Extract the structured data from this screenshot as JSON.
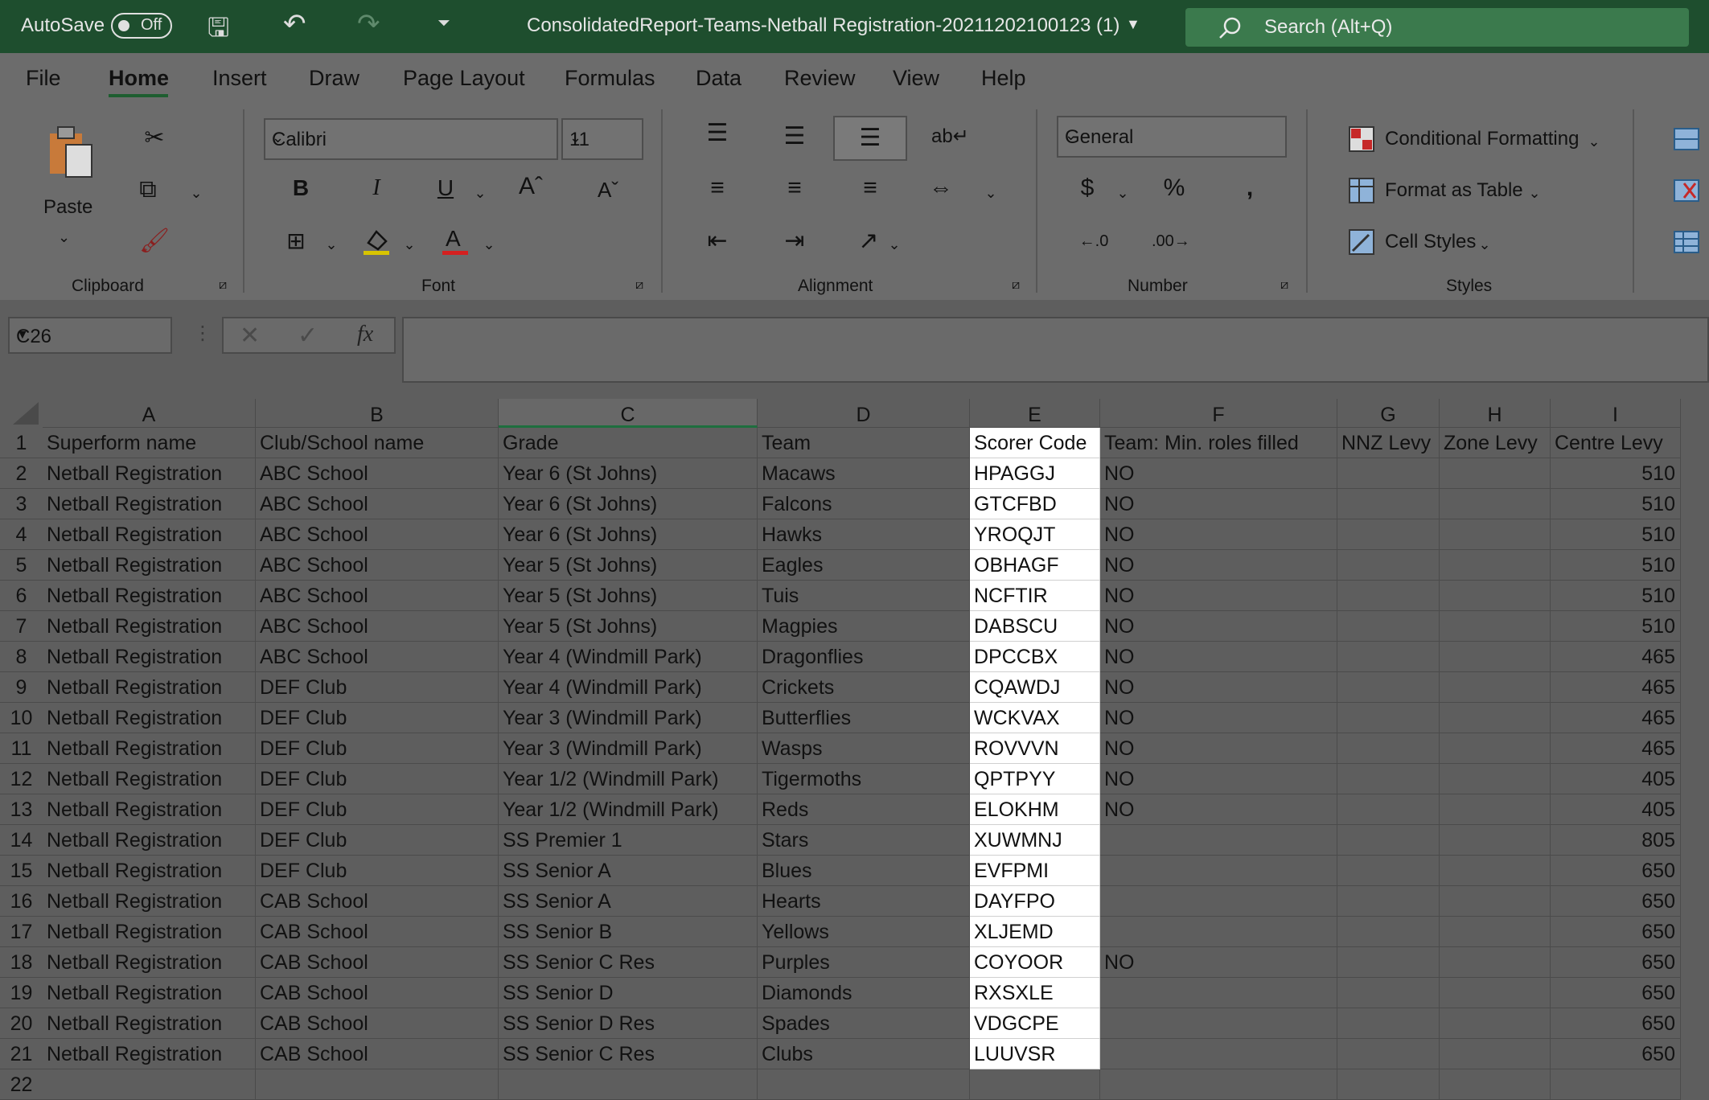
{
  "titlebar": {
    "autosave_label": "AutoSave",
    "autosave_state": "Off",
    "filename": "ConsolidatedReport-Teams-Netball Registration-20211202100123 (1)",
    "search_placeholder": "Search (Alt+Q)"
  },
  "tabs": [
    "File",
    "Home",
    "Insert",
    "Draw",
    "Page Layout",
    "Formulas",
    "Data",
    "Review",
    "View",
    "Help"
  ],
  "ribbon": {
    "paste_label": "Paste",
    "font_name": "Calibri",
    "font_size": "11",
    "number_format": "General",
    "conditional_formatting": "Conditional Formatting",
    "format_as_table": "Format as Table",
    "cell_styles": "Cell Styles",
    "groups": {
      "clipboard": "Clipboard",
      "font": "Font",
      "alignment": "Alignment",
      "number": "Number",
      "styles": "Styles"
    }
  },
  "formula_bar": {
    "name_box": "C26",
    "fx": "fx",
    "formula": ""
  },
  "columns": [
    "A",
    "B",
    "C",
    "D",
    "E",
    "F",
    "G",
    "H",
    "I"
  ],
  "rows": [
    [
      "1",
      "Superform name",
      "Club/School name",
      "Grade",
      "Team",
      "Scorer Code",
      "Team: Min. roles filled",
      "NNZ Levy",
      "Zone Levy",
      "Centre Levy"
    ],
    [
      "2",
      "Netball Registration",
      "ABC School",
      "Year 6 (St Johns)",
      "Macaws",
      "HPAGGJ",
      "NO",
      "",
      "",
      "510"
    ],
    [
      "3",
      "Netball Registration",
      "ABC School",
      "Year 6 (St Johns)",
      "Falcons",
      "GTCFBD",
      "NO",
      "",
      "",
      "510"
    ],
    [
      "4",
      "Netball Registration",
      "ABC School",
      "Year 6 (St Johns)",
      "Hawks",
      "YROQJT",
      "NO",
      "",
      "",
      "510"
    ],
    [
      "5",
      "Netball Registration",
      "ABC School",
      "Year 5 (St Johns)",
      "Eagles",
      "OBHAGF",
      "NO",
      "",
      "",
      "510"
    ],
    [
      "6",
      "Netball Registration",
      "ABC School",
      "Year 5 (St Johns)",
      "Tuis",
      "NCFTIR",
      "NO",
      "",
      "",
      "510"
    ],
    [
      "7",
      "Netball Registration",
      "ABC School",
      "Year 5 (St Johns)",
      "Magpies",
      "DABSCU",
      "NO",
      "",
      "",
      "510"
    ],
    [
      "8",
      "Netball Registration",
      "ABC School",
      "Year 4 (Windmill Park)",
      "Dragonflies",
      "DPCCBX",
      "NO",
      "",
      "",
      "465"
    ],
    [
      "9",
      "Netball Registration",
      "DEF Club",
      "Year 4 (Windmill Park)",
      "Crickets",
      "CQAWDJ",
      "NO",
      "",
      "",
      "465"
    ],
    [
      "10",
      "Netball Registration",
      "DEF Club",
      "Year 3 (Windmill Park)",
      "Butterflies",
      "WCKVAX",
      "NO",
      "",
      "",
      "465"
    ],
    [
      "11",
      "Netball Registration",
      "DEF Club",
      "Year 3 (Windmill Park)",
      "Wasps",
      "ROVVVN",
      "NO",
      "",
      "",
      "465"
    ],
    [
      "12",
      "Netball Registration",
      "DEF Club",
      "Year 1/2 (Windmill Park)",
      "Tigermoths",
      "QPTPYY",
      "NO",
      "",
      "",
      "405"
    ],
    [
      "13",
      "Netball Registration",
      "DEF Club",
      "Year 1/2 (Windmill Park)",
      "Reds",
      "ELOKHM",
      "NO",
      "",
      "",
      "405"
    ],
    [
      "14",
      "Netball Registration",
      "DEF Club",
      "SS Premier 1",
      "Stars",
      "XUWMNJ",
      "",
      "",
      "",
      "805"
    ],
    [
      "15",
      "Netball Registration",
      "DEF Club",
      "SS Senior A",
      "Blues",
      "EVFPMI",
      "",
      "",
      "",
      "650"
    ],
    [
      "16",
      "Netball Registration",
      "CAB School",
      "SS Senior A",
      "Hearts",
      "DAYFPO",
      "",
      "",
      "",
      "650"
    ],
    [
      "17",
      "Netball Registration",
      "CAB School",
      "SS Senior B",
      "Yellows",
      "XLJEMD",
      "",
      "",
      "",
      "650"
    ],
    [
      "18",
      "Netball Registration",
      "CAB School",
      "SS Senior C Res",
      "Purples",
      "COYOOR",
      "NO",
      "",
      "",
      "650"
    ],
    [
      "19",
      "Netball Registration",
      "CAB School",
      "SS Senior D",
      "Diamonds",
      "RXSXLE",
      "",
      "",
      "",
      "650"
    ],
    [
      "20",
      "Netball Registration",
      "CAB School",
      "SS Senior D Res",
      "Spades",
      "VDGCPE",
      "",
      "",
      "",
      "650"
    ],
    [
      "21",
      "Netball Registration",
      "CAB School",
      "SS Senior C Res",
      "Clubs",
      "LUUVSR",
      "",
      "",
      "",
      "650"
    ],
    [
      "22",
      "",
      "",
      "",
      "",
      "",
      "",
      "",
      "",
      ""
    ]
  ]
}
